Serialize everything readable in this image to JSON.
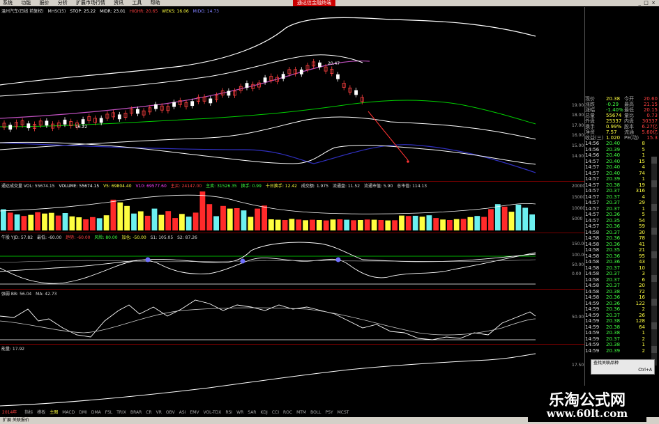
{
  "menubar": {
    "items": [
      "系统",
      "功能",
      "报价",
      "分析",
      "扩展市场行情",
      "资讯",
      "工具",
      "帮助"
    ],
    "promo": "通达信金融终端"
  },
  "main_chart": {
    "legend": [
      "温州汽车(日线 前复权)",
      "MHS(15)",
      "STOP: 25.22",
      "MIDR: 23.01",
      "HIGHR: 20.65",
      "WEKS: 16.06",
      "MIDG: 14.73"
    ],
    "price_labels": {
      "high": "20.47",
      "low": "16.22"
    },
    "scale": [
      "19.00",
      "18.00",
      "17.00",
      "16.00",
      "15.00",
      "14.00"
    ],
    "annotation_color": "#ff3333"
  },
  "volume": {
    "legend": [
      "通达成交量 VOL: 55674.15",
      "VOLUME: 55674.15",
      "V5: 69804.40",
      "V10: 69577.60",
      "主买: 24147.00",
      "主卖: 31526.35",
      "换手: 0.99",
      "十日换手: 12.42",
      "成交额: 1.975",
      "流通盘: 11.52",
      "流通市值: 5.90",
      "总市值: 114.13"
    ],
    "scale": [
      "20000",
      "15000",
      "10000",
      "5000",
      "0"
    ],
    "bars": [
      {
        "v": 9500,
        "c": "cyan"
      },
      {
        "v": 8000,
        "c": "red"
      },
      {
        "v": 7200,
        "c": "cyan"
      },
      {
        "v": 6500,
        "c": "red"
      },
      {
        "v": 7000,
        "c": "yellow"
      },
      {
        "v": 8200,
        "c": "red"
      },
      {
        "v": 7600,
        "c": "yellow"
      },
      {
        "v": 7900,
        "c": "yellow"
      },
      {
        "v": 6700,
        "c": "red"
      },
      {
        "v": 7800,
        "c": "cyan"
      },
      {
        "v": 6300,
        "c": "yellow"
      },
      {
        "v": 5900,
        "c": "yellow"
      },
      {
        "v": 5000,
        "c": "red"
      },
      {
        "v": 6000,
        "c": "red"
      },
      {
        "v": 5500,
        "c": "cyan"
      },
      {
        "v": 6800,
        "c": "yellow"
      },
      {
        "v": 13800,
        "c": "red"
      },
      {
        "v": 12600,
        "c": "yellow"
      },
      {
        "v": 11000,
        "c": "yellow"
      },
      {
        "v": 7600,
        "c": "cyan"
      },
      {
        "v": 8600,
        "c": "yellow"
      },
      {
        "v": 6600,
        "c": "red"
      },
      {
        "v": 9800,
        "c": "cyan"
      },
      {
        "v": 7000,
        "c": "yellow"
      },
      {
        "v": 8700,
        "c": "red"
      },
      {
        "v": 5600,
        "c": "red"
      },
      {
        "v": 7400,
        "c": "yellow"
      },
      {
        "v": 6200,
        "c": "cyan"
      },
      {
        "v": 8000,
        "c": "red"
      },
      {
        "v": 17500,
        "c": "red"
      },
      {
        "v": 11800,
        "c": "red"
      },
      {
        "v": 6400,
        "c": "cyan"
      },
      {
        "v": 11000,
        "c": "red"
      },
      {
        "v": 9800,
        "c": "yellow"
      },
      {
        "v": 10000,
        "c": "red"
      },
      {
        "v": 9000,
        "c": "cyan"
      },
      {
        "v": 6100,
        "c": "yellow"
      },
      {
        "v": 9800,
        "c": "red"
      },
      {
        "v": 11200,
        "c": "red"
      },
      {
        "v": 5000,
        "c": "yellow"
      },
      {
        "v": 4800,
        "c": "yellow"
      },
      {
        "v": 4700,
        "c": "red"
      },
      {
        "v": 5200,
        "c": "yellow"
      },
      {
        "v": 4900,
        "c": "red"
      },
      {
        "v": 4600,
        "c": "yellow"
      },
      {
        "v": 4800,
        "c": "red"
      },
      {
        "v": 4700,
        "c": "yellow"
      },
      {
        "v": 4500,
        "c": "red"
      },
      {
        "v": 4900,
        "c": "yellow"
      },
      {
        "v": 5000,
        "c": "red"
      },
      {
        "v": 4800,
        "c": "cyan"
      },
      {
        "v": 4600,
        "c": "red"
      },
      {
        "v": 4700,
        "c": "yellow"
      },
      {
        "v": 4900,
        "c": "red"
      },
      {
        "v": 4800,
        "c": "yellow"
      },
      {
        "v": 4700,
        "c": "red"
      },
      {
        "v": 4500,
        "c": "yellow"
      },
      {
        "v": 4600,
        "c": "red"
      },
      {
        "v": 6700,
        "c": "yellow"
      },
      {
        "v": 6500,
        "c": "red"
      },
      {
        "v": 6600,
        "c": "cyan"
      },
      {
        "v": 6200,
        "c": "yellow"
      },
      {
        "v": 6800,
        "c": "cyan"
      },
      {
        "v": 5600,
        "c": "red"
      },
      {
        "v": 4900,
        "c": "yellow"
      },
      {
        "v": 4700,
        "c": "red"
      },
      {
        "v": 5100,
        "c": "yellow"
      },
      {
        "v": 5200,
        "c": "red"
      },
      {
        "v": 6000,
        "c": "yellow"
      },
      {
        "v": 6500,
        "c": "cyan"
      },
      {
        "v": 6100,
        "c": "red"
      },
      {
        "v": 9600,
        "c": "red"
      },
      {
        "v": 11800,
        "c": "cyan"
      },
      {
        "v": 10700,
        "c": "red"
      },
      {
        "v": 8400,
        "c": "yellow"
      },
      {
        "v": 11600,
        "c": "cyan"
      },
      {
        "v": 10200,
        "c": "cyan"
      },
      {
        "v": 7200,
        "c": "cyan"
      }
    ]
  },
  "pane3": {
    "legend": [
      "牛股 YJD: 57.82",
      "最低: -60.00",
      "趋势: -60.00",
      "风险: 80.00",
      "加仓: -50.00",
      "S1: 105.05",
      "S2: 87.26"
    ],
    "scale": [
      "150.00",
      "100.00",
      "50.00",
      "0.00"
    ]
  },
  "pane4": {
    "legend": [
      "强弱 BB: 56.04",
      "MA: 42.73"
    ],
    "scale": [
      "50.00"
    ]
  },
  "pane5": {
    "legend": [
      "能量: 17.92"
    ],
    "scale": [
      "17.50"
    ]
  },
  "sidepanel": {
    "quotes": [
      {
        "l1": "现价",
        "v1": "20.38",
        "l2": "今开",
        "v2": "20.60"
      },
      {
        "l1": "涨跌",
        "v1": "-0.29",
        "l2": "最高",
        "v2": "21.15"
      },
      {
        "l1": "涨幅",
        "v1": "-1.40%",
        "l2": "最低",
        "v2": "20.15"
      },
      {
        "l1": "总量",
        "v1": "55674",
        "l2": "量比",
        "v2": "0.73"
      },
      {
        "l1": "外盘",
        "v1": "25337",
        "l2": "内盘",
        "v2": "30337"
      },
      {
        "l1": "换手",
        "v1": "0.99%",
        "l2": "股本",
        "v2": "6.27亿"
      },
      {
        "l1": "净资",
        "v1": "7.57",
        "l2": "流通",
        "v2": "5.60亿"
      },
      {
        "l1": "收益(三)",
        "v1": "1.020",
        "l2": "PE(动)",
        "v2": "15.3"
      }
    ],
    "ticks": [
      [
        "14:56",
        "20.40",
        "8",
        ""
      ],
      [
        "14:56",
        "20.39",
        "5",
        ""
      ],
      [
        "14:56",
        "20.40",
        "1",
        ""
      ],
      [
        "14:57",
        "20.40",
        "15",
        ""
      ],
      [
        "14:57",
        "20.40",
        "4",
        ""
      ],
      [
        "14:57",
        "20.40",
        "74",
        ""
      ],
      [
        "14:57",
        "20.39",
        "1",
        ""
      ],
      [
        "14:57",
        "20.38",
        "19",
        ""
      ],
      [
        "14:57",
        "20.37",
        "316",
        ""
      ],
      [
        "14:57",
        "20.37",
        "4",
        ""
      ],
      [
        "14:57",
        "20.37",
        "29",
        ""
      ],
      [
        "14:57",
        "20.37",
        "1",
        ""
      ],
      [
        "14:57",
        "20.36",
        "5",
        ""
      ],
      [
        "14:57",
        "20.35",
        "54",
        ""
      ],
      [
        "14:57",
        "20.36",
        "59",
        ""
      ],
      [
        "14:58",
        "20.37",
        "30",
        ""
      ],
      [
        "14:58",
        "20.36",
        "78",
        ""
      ],
      [
        "14:58",
        "20.36",
        "41",
        ""
      ],
      [
        "14:58",
        "20.35",
        "21",
        ""
      ],
      [
        "14:58",
        "20.36",
        "95",
        ""
      ],
      [
        "14:58",
        "20.36",
        "43",
        ""
      ],
      [
        "14:58",
        "20.37",
        "10",
        ""
      ],
      [
        "14:58",
        "20.37",
        "3",
        ""
      ],
      [
        "14:58",
        "20.37",
        "6",
        ""
      ],
      [
        "14:58",
        "20.37",
        "20",
        ""
      ],
      [
        "14:58",
        "20.38",
        "72",
        ""
      ],
      [
        "14:58",
        "20.36",
        "16",
        ""
      ],
      [
        "14:59",
        "20.36",
        "122",
        ""
      ],
      [
        "14:59",
        "20.36",
        "2",
        ""
      ],
      [
        "14:59",
        "20.37",
        "26",
        ""
      ],
      [
        "14:59",
        "20.38",
        "128",
        ""
      ],
      [
        "14:59",
        "20.38",
        "64",
        ""
      ],
      [
        "14:59",
        "20.38",
        "1",
        ""
      ],
      [
        "14:59",
        "20.37",
        "2",
        ""
      ],
      [
        "14:59",
        "20.38",
        "1",
        ""
      ],
      [
        "14:59",
        "20.39",
        "2",
        ""
      ]
    ]
  },
  "popup": {
    "item1": "查找关联品种",
    "item2": "Ctrl+A"
  },
  "tabbar": {
    "date": "2014年",
    "tabs": [
      "指标",
      "模板",
      "主图",
      "MACD",
      "DMI",
      "DMA",
      "FSL",
      "TRIX",
      "BRAR",
      "CR",
      "VR",
      "OBV",
      "ASI",
      "EMV",
      "VOL-TDX",
      "RSI",
      "WR",
      "SAR",
      "KDJ",
      "CCI",
      "ROC",
      "MTM",
      "BOLL",
      "PSY",
      "MCST"
    ]
  },
  "statusbar": {
    "text": "扩展  关联报价"
  },
  "watermark": {
    "cn": "乐淘公式网",
    "url": "www.60lt.com"
  },
  "colors": {
    "red": "#ff2a2a",
    "cyan": "#6cf0f0",
    "yellow": "#ffff40",
    "green": "#00ff00",
    "white": "#ffffff",
    "magenta": "#c050c0",
    "blue": "#3030c0"
  }
}
